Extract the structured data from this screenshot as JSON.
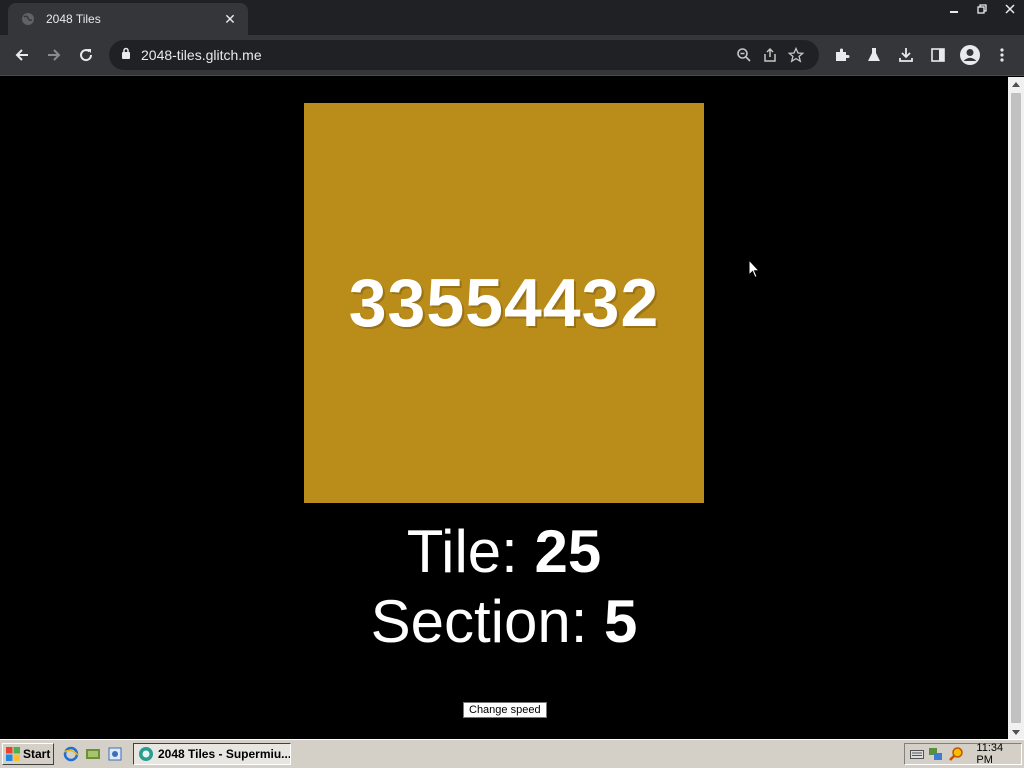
{
  "browser": {
    "tab_title": "2048 Tiles",
    "tab_close": "✕",
    "url": "2048-tiles.glitch.me"
  },
  "page": {
    "tile_value": "33554432",
    "tile_color": "#ba8c19",
    "tile_label": "Tile: ",
    "tile_number": "25",
    "section_label": "Section: ",
    "section_number": "5",
    "speed_button": "Change speed"
  },
  "taskbar": {
    "start_label": "Start",
    "task_label": "2048 Tiles - Supermiu...",
    "clock": "11:34 PM"
  },
  "icons": {
    "tab_favicon": "globe-icon",
    "back": "back-arrow-icon",
    "forward": "forward-arrow-icon",
    "reload": "reload-icon",
    "lock": "lock-icon",
    "zoom": "zoom-out-icon",
    "share": "share-icon",
    "bookmark": "star-icon",
    "extensions": "puzzle-icon",
    "labs": "flask-icon",
    "download": "download-icon",
    "side_panel": "side-panel-icon",
    "profile": "profile-icon",
    "menu": "kebab-menu-icon"
  }
}
